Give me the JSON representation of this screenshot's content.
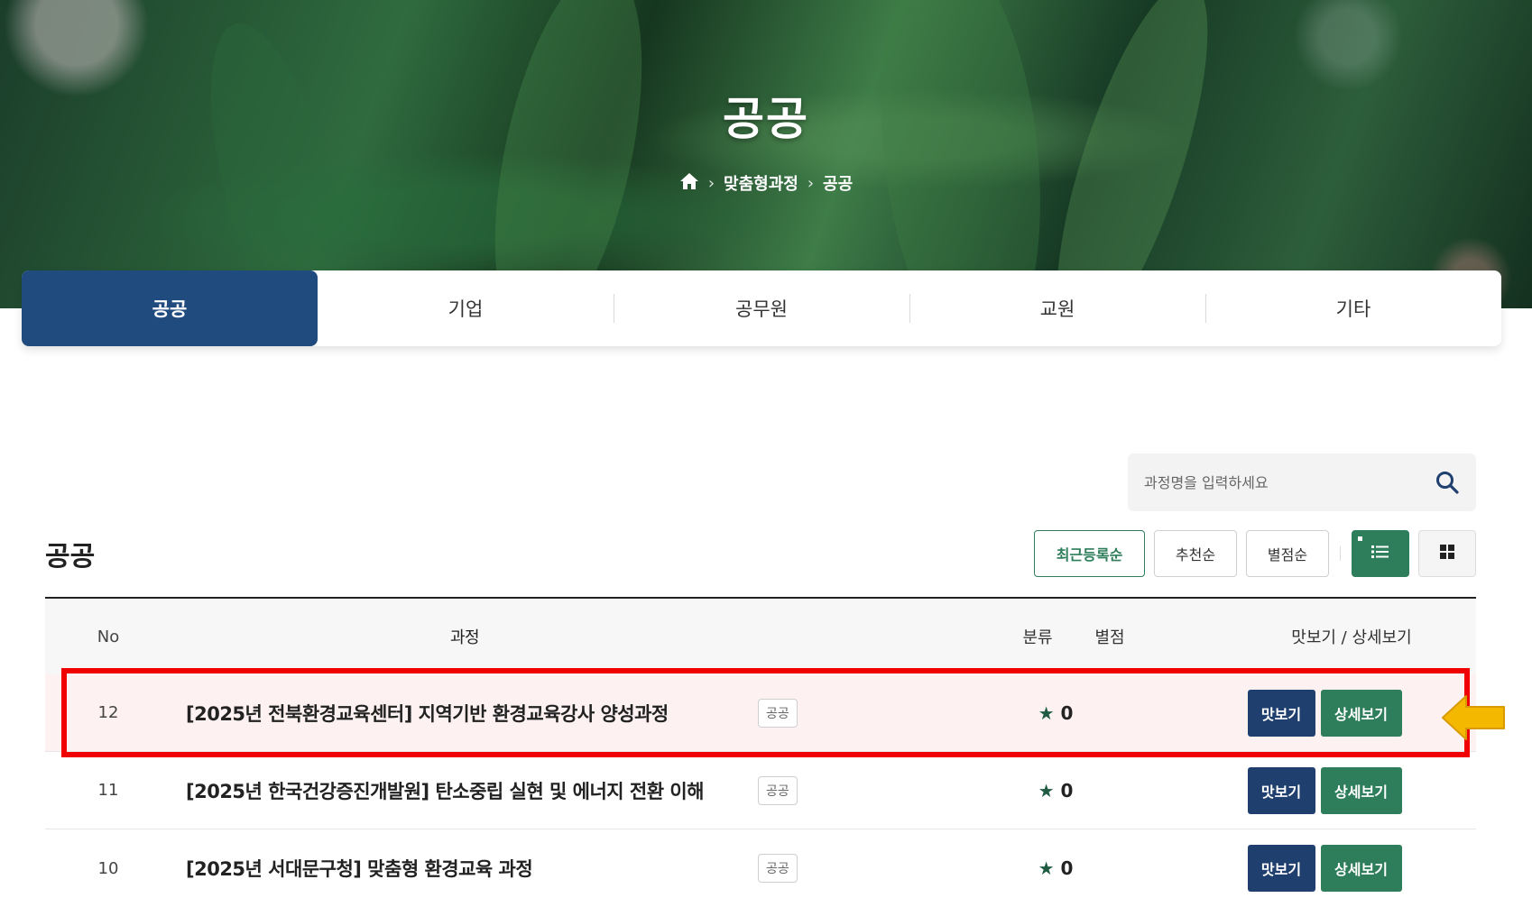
{
  "hero": {
    "title": "공공",
    "breadcrumb": [
      "맞춤형과정",
      "공공"
    ]
  },
  "tabs": [
    {
      "label": "공공",
      "active": true
    },
    {
      "label": "기업",
      "active": false
    },
    {
      "label": "공무원",
      "active": false
    },
    {
      "label": "교원",
      "active": false
    },
    {
      "label": "기타",
      "active": false
    }
  ],
  "search": {
    "placeholder": "과정명을 입력하세요",
    "value": ""
  },
  "section_title": "공공",
  "sort": {
    "recent": "최근등록순",
    "recommended": "추천순",
    "rating": "별점순"
  },
  "view_modes": {
    "list": "list-icon",
    "grid": "grid-icon",
    "active": "list"
  },
  "table": {
    "headers": {
      "no": "No",
      "course": "과정",
      "category": "분류",
      "rating": "별점",
      "actions": "맛보기 / 상세보기"
    },
    "rows": [
      {
        "no": "12",
        "title": "[2025년 전북환경교육센터] 지역기반 환경교육강사 양성과정",
        "category": "공공",
        "rating": "0",
        "preview": "맛보기",
        "detail": "상세보기"
      },
      {
        "no": "11",
        "title": "[2025년 한국건강증진개발원] 탄소중립 실현 및 에너지 전환 이해",
        "category": "공공",
        "rating": "0",
        "preview": "맛보기",
        "detail": "상세보기"
      },
      {
        "no": "10",
        "title": "[2025년 서대문구청] 맞춤형 환경교육 과정",
        "category": "공공",
        "rating": "0",
        "preview": "맛보기",
        "detail": "상세보기"
      }
    ]
  },
  "colors": {
    "primary_navy": "#1f4b7e",
    "button_navy": "#1f3f6e",
    "green": "#2e7d5b",
    "highlight_red": "#f00000",
    "arrow_yellow": "#f5b800"
  }
}
